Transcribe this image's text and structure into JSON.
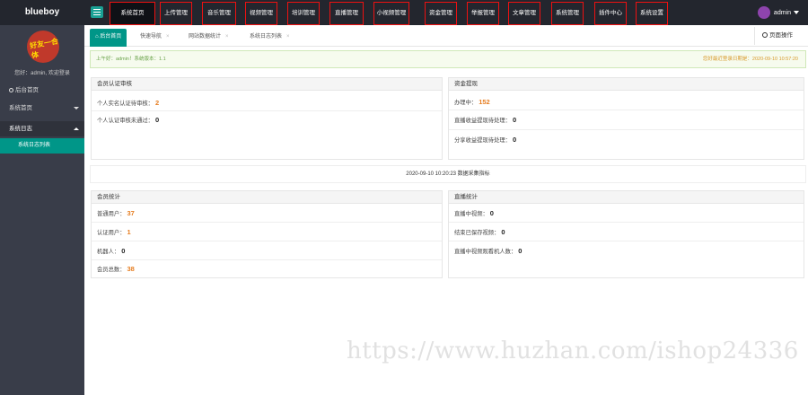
{
  "header": {
    "brand": "blueboy",
    "nav": [
      {
        "label": "系统首页",
        "active": true
      },
      {
        "label": "上传管理"
      },
      {
        "label": "音乐管理"
      },
      {
        "label": "视频管理"
      },
      {
        "label": "培训管理"
      },
      {
        "label": "直播管理"
      },
      {
        "label": "小视频管理"
      },
      {
        "label": "资金管理"
      },
      {
        "label": "举报管理"
      },
      {
        "label": "文章管理"
      },
      {
        "label": "系统管理"
      },
      {
        "label": "插件中心"
      },
      {
        "label": "系统设置"
      }
    ],
    "user": "admin"
  },
  "sidebar": {
    "avatar_text": "好友一合体",
    "welcome": "您好：admin, 欢迎登录",
    "items": {
      "home": "后台首页",
      "system_home": "系统首页",
      "system_log": "系统日志",
      "system_log_sub": "系统日志列表"
    }
  },
  "tabs": {
    "items": [
      {
        "label": "后台首页",
        "active": true
      },
      {
        "label": "快速导航"
      },
      {
        "label": "网站数据统计"
      },
      {
        "label": "系统日志列表"
      }
    ],
    "page_op": "页面操作"
  },
  "alert": {
    "left": "上午好：admin！系统版本：1.1",
    "right": "您好最近登录日期是：2020-09-10 10:57:20"
  },
  "panels": {
    "verify": {
      "title": "会员认证审核",
      "rows": [
        {
          "label": "个人实名认证待审核：",
          "value": "2",
          "accent": true
        },
        {
          "label": "个人认证审核未通过：",
          "value": "0",
          "accent": false
        }
      ]
    },
    "finance": {
      "title": "资金提现",
      "rows": [
        {
          "label": "办理中：",
          "value": "152",
          "accent": true
        },
        {
          "label": "直播收益提现待处理：",
          "value": "0",
          "accent": false
        },
        {
          "label": "分享收益提现待处理：",
          "value": "0",
          "accent": false
        }
      ]
    },
    "timestamp": "2020-09-10 10:20:23 数据采集指标",
    "members": {
      "title": "会员统计",
      "rows": [
        {
          "label": "普通用户：",
          "value": "37",
          "accent": true
        },
        {
          "label": "认证用户：",
          "value": "1",
          "accent": true
        },
        {
          "label": "机器人：",
          "value": "0",
          "accent": false
        },
        {
          "label": "会员总数：",
          "value": "38",
          "accent": true
        }
      ]
    },
    "live": {
      "title": "直播统计",
      "rows": [
        {
          "label": "直播中视频：",
          "value": "0",
          "accent": false
        },
        {
          "label": "结束已保存视频：",
          "value": "0",
          "accent": false
        },
        {
          "label": "直播中视频观看机人数：",
          "value": "0",
          "accent": false
        }
      ]
    }
  },
  "watermark": "https://www.huzhan.com/ishop24336",
  "colors": {
    "topbar": "#23262e",
    "sidebar": "#393d49",
    "accent": "#009688",
    "highlight_value": "#e67e22",
    "nav_outline": "#e11111"
  }
}
